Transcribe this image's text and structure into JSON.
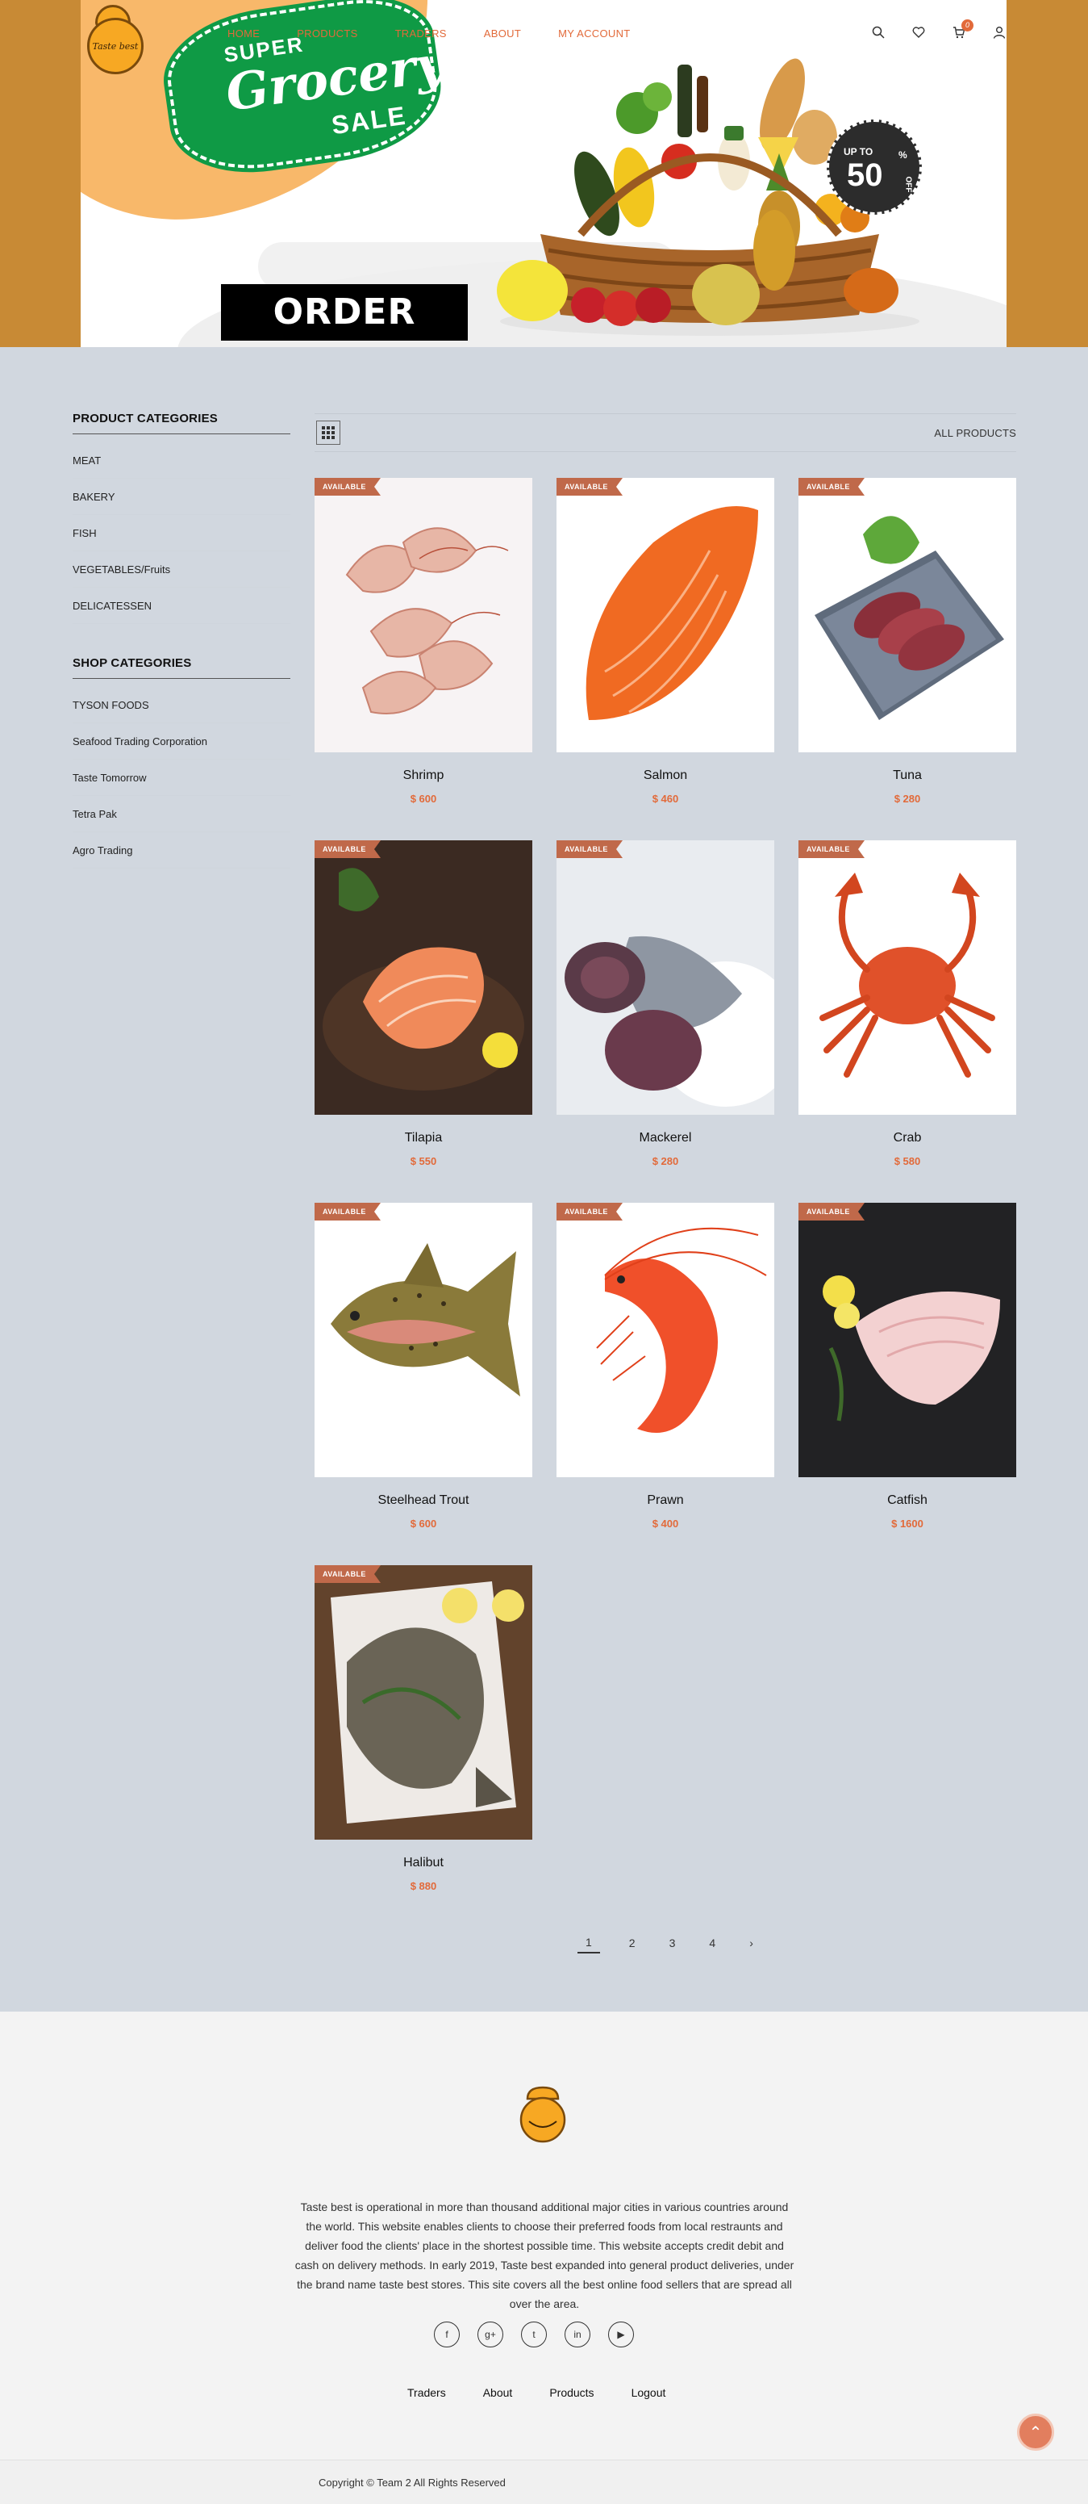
{
  "brand": {
    "logo_text": "Taste best"
  },
  "nav": [
    "HOME",
    "PRODUCTS",
    "TRADERS",
    "ABOUT",
    "MY ACCOUNT"
  ],
  "header": {
    "cart_count": "0"
  },
  "hero": {
    "sale_top": "SUPER",
    "sale_middle": "Grocery",
    "sale_bottom": "SALE",
    "order_button": "ORDER NOW",
    "discount_prefix": "UP TO",
    "discount_value": "50",
    "discount_unit": "%",
    "discount_suffix": "OFF"
  },
  "sidebar": {
    "product_title": "PRODUCT CATEGORIES",
    "product_categories": [
      "MEAT",
      "BAKERY",
      "FISH",
      "VEGETABLES/Fruits",
      "DELICATESSEN"
    ],
    "shop_title": "SHOP CATEGORIES",
    "shop_categories": [
      "TYSON FOODS",
      "Seafood Trading Corporation",
      "Taste Tomorrow",
      "Tetra Pak",
      "Agro Trading"
    ]
  },
  "toolbar": {
    "all_products": "ALL PRODUCTS"
  },
  "product_badge": "AVAILABLE",
  "products": [
    {
      "name": "Shrimp",
      "price": "$ 600",
      "icon": "shrimp-icon"
    },
    {
      "name": "Salmon",
      "price": "$ 460",
      "icon": "salmon-fillet-icon"
    },
    {
      "name": "Tuna",
      "price": "$ 280",
      "icon": "tuna-slices-icon"
    },
    {
      "name": "Tilapia",
      "price": "$ 550",
      "icon": "tilapia-fillet-icon"
    },
    {
      "name": "Mackerel",
      "price": "$ 280",
      "icon": "mackerel-steak-icon"
    },
    {
      "name": "Crab",
      "price": "$ 580",
      "icon": "crab-icon"
    },
    {
      "name": "Steelhead Trout",
      "price": "$ 600",
      "icon": "trout-icon"
    },
    {
      "name": "Prawn",
      "price": "$ 400",
      "icon": "prawn-icon"
    },
    {
      "name": "Catfish",
      "price": "$ 1600",
      "icon": "catfish-fillet-icon"
    },
    {
      "name": "Halibut",
      "price": "$ 880",
      "icon": "halibut-icon"
    }
  ],
  "pagination": {
    "pages": [
      "1",
      "2",
      "3",
      "4"
    ],
    "next": "›",
    "current": "1"
  },
  "footer": {
    "about": "Taste best is operational in more than thousand additional major cities in various countries around the world. This website enables clients to choose their preferred foods from local restraunts and deliver food the clients' place in the shortest possible time. This website accepts credit debit and cash on delivery methods. In early 2019, Taste best expanded into general product deliveries, under the brand name taste best stores. This site covers all the best online food sellers that are spread all over the area.",
    "social": [
      "f",
      "g+",
      "t",
      "in",
      "▶"
    ],
    "links": [
      "Traders",
      "About",
      "Products",
      "Logout"
    ],
    "copyright": "Copyright © Team 2 All Rights Reserved",
    "to_top": "⌃"
  },
  "colors": {
    "accent": "#e26a3a",
    "badge": "#c0694a",
    "hero_bg": "#c88a35",
    "main_bg": "#d1d7df",
    "sale_green": "#0f9a45"
  }
}
